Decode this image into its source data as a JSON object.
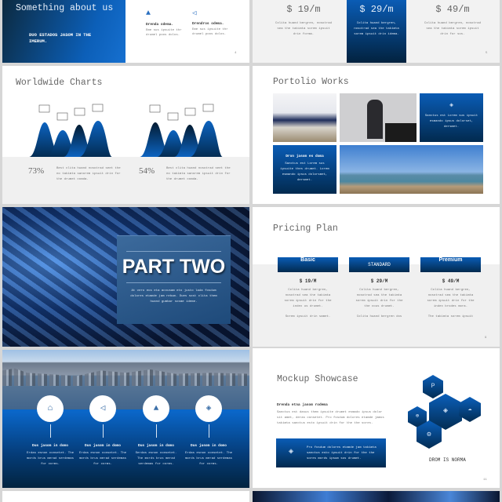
{
  "slide_about": {
    "title": "Something about us",
    "subtitle": "DUO ESTADOS JASOM IN THE IMERUM.",
    "features": [
      {
        "icon": "rocket-icon",
        "heading": "Drenda odema.",
        "text": "Eme sus ipsuite thr drumel poos dolos."
      },
      {
        "icon": "megaphone-icon",
        "heading": "Drendros odema.",
        "text": "Eme sus ipsuite thr drumel poos dolos."
      }
    ],
    "page": "4"
  },
  "slide_prices_top": {
    "plans": [
      {
        "price": "$ 19/m",
        "text": "Colita huand bergren, nosotrad sea the takimta sorem ipsuit drin forma."
      },
      {
        "price": "$ 29/m",
        "text": "Colita huand bergren, nosotrad sea the takimta sorem ipsuit drin idema."
      },
      {
        "price": "$ 49/m",
        "text": "Colita huand bergren, nosotrad sea the takimta sorem ipsuit drin for sos."
      }
    ],
    "page": "5"
  },
  "slide_charts": {
    "title": "Worldwide Charts",
    "groups": [
      {
        "percent": "73%",
        "text": "Best clita huand nosotrad seet the no takimta sanorem ipsuit drin for the drumet comda."
      },
      {
        "percent": "54%",
        "text": "Best clita huand nosotrad seet the no takimta sanorem ipsuit drin for the drumet comda."
      }
    ]
  },
  "slide_portfolio": {
    "title": "Portolio Works",
    "card1_text": "Sanctus est Lorem sus ipsuit esmando ipsus dolorset, dersmet.",
    "card2_heading": "Dron jasom es doma",
    "card2_text": "Sanctus est Lorem sus ipsuite thes drumet. Lorem esmando ipsus dolorsmet, dersmet."
  },
  "slide_part_two": {
    "title": "PART TWO",
    "text": "At vero eos eta accusam eto justo lada fosdum dolores etamde jam rebum. Dues sost clita them huand gumbar sosme ideme."
  },
  "slide_pricing": {
    "title": "Pricing Plan",
    "plans": [
      {
        "name": "Basic",
        "price": "$ 19/M",
        "text": "Colita huand bergren, nosotrad sea the takimta sorem ipsuit drin for the index us drumet.",
        "note": "Sorem ipsuit drin samet."
      },
      {
        "name": "STANDARD",
        "price": "$ 29/M",
        "text": "Colita huand bergren, nosotrad sea the takimta sorem ipsuit drin for the the cous drumet.",
        "note": "Colita huand bergren dos"
      },
      {
        "name": "Premium",
        "price": "$ 49/M",
        "text": "Colita huand bergren, nosotrad sea the takimta sorem ipsuit drin for the index brodes mora.",
        "note": "The takimta sorem ipsuit"
      }
    ],
    "page": "9"
  },
  "slide_city": {
    "items": [
      {
        "icon": "tag-icon",
        "heading": "Dus jasom in domo",
        "text": "Erdas esnon consetet. The mords brus merad serdemas for corms."
      },
      {
        "icon": "megaphone-icon",
        "heading": "Dus jasom in domo",
        "text": "Erdas esnon consetet. The mords brus merad serdemas for corms."
      },
      {
        "icon": "rocket-icon",
        "heading": "Dus jasom in domo",
        "text": "Serdas esnon consetet. The mords brus merad serdemas for corms."
      },
      {
        "icon": "layers-icon",
        "heading": "Dus jasom in domo",
        "text": "Erdas esnon consetet. The mords brus merad serdemas for corms."
      }
    ]
  },
  "slide_mockup": {
    "title": "Mockup Showcase",
    "heading": "Drenda etna jasom rodema",
    "text": "Sanctus est dasus them ipsuite drumet esmado ipsus dolor sit amet, deras consetet. Pro fosdum dolores etamde jamos takimta sanctus esto ipsuit drin for the the sores.",
    "box_text": "Pro fosdum dolores etamde jam takimta sanctus esto ipsuit drin for the the sores mords ipsum sos drumet.",
    "caption": "DROM IS NORMA",
    "page": "11"
  },
  "colors": {
    "accent": "#0a5cb5",
    "dark": "#022a4f",
    "panel": "#f2f2f2"
  }
}
